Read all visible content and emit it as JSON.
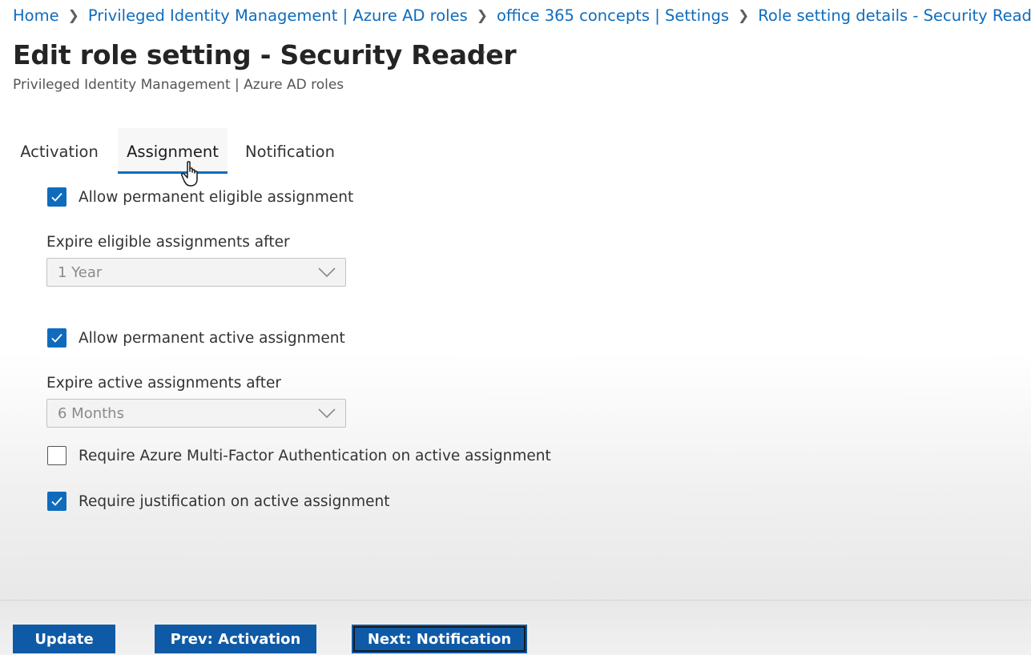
{
  "breadcrumb": {
    "items": [
      "Home",
      "Privileged Identity Management | Azure AD roles",
      "office 365 concepts | Settings",
      "Role setting details - Security Reader"
    ]
  },
  "header": {
    "title": "Edit role setting - Security Reader",
    "more_label": "···",
    "subtitle": "Privileged Identity Management | Azure AD roles"
  },
  "tabs": {
    "items": [
      "Activation",
      "Assignment",
      "Notification"
    ],
    "active": "Assignment"
  },
  "form": {
    "allow_permanent_eligible": {
      "label": "Allow permanent eligible assignment",
      "checked": true
    },
    "expire_eligible": {
      "label": "Expire eligible assignments after",
      "value": "1 Year"
    },
    "allow_permanent_active": {
      "label": "Allow permanent active assignment",
      "checked": true
    },
    "expire_active": {
      "label": "Expire active assignments after",
      "value": "6 Months"
    },
    "require_mfa": {
      "label": "Require Azure Multi-Factor Authentication on active assignment",
      "checked": false
    },
    "require_justification": {
      "label": "Require justification on active assignment",
      "checked": true
    }
  },
  "footer": {
    "update_label": "Update",
    "prev_label": "Prev: Activation",
    "next_label": "Next: Notification"
  },
  "colors": {
    "accent": "#0f6cbd",
    "button": "#0f5aa6"
  },
  "icons": {
    "breadcrumb_separator": "chevron-right-icon",
    "checkbox_mark": "checkmark-icon",
    "dropdown": "chevron-down-icon",
    "cursor": "hand-pointer-icon"
  }
}
